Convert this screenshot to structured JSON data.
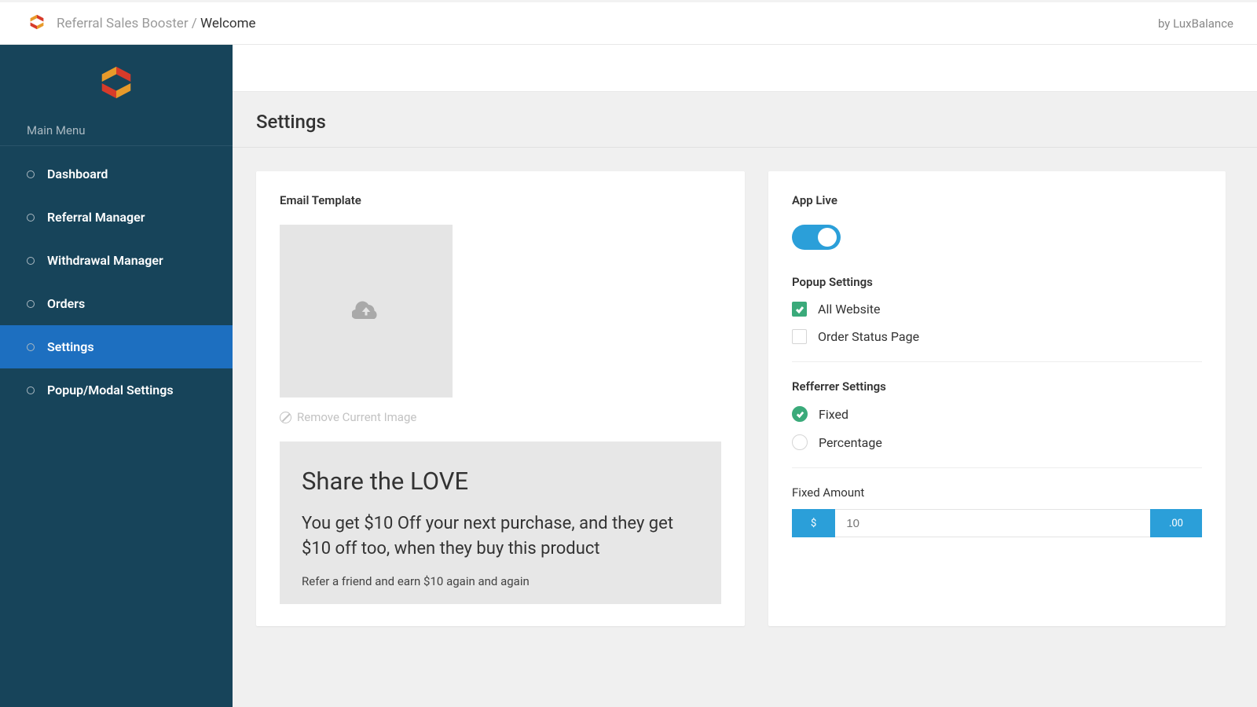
{
  "topbar": {
    "app_name": "Referral Sales Booster",
    "separator": " / ",
    "current": "Welcome",
    "by_text": "by LuxBalance"
  },
  "sidebar": {
    "section_label": "Main Menu",
    "items": [
      {
        "label": "Dashboard"
      },
      {
        "label": "Referral Manager"
      },
      {
        "label": "Withdrawal Manager"
      },
      {
        "label": "Orders"
      },
      {
        "label": "Settings"
      },
      {
        "label": "Popup/Modal Settings"
      }
    ]
  },
  "page": {
    "title": "Settings"
  },
  "left": {
    "email_template_label": "Email Template",
    "remove_image_label": "Remove Current Image",
    "preview_title": "Share the LOVE",
    "preview_body": "You get $10 Off your next purchase, and they get $10 off too, when they buy this product",
    "preview_sub": "Refer a friend and earn $10 again and again"
  },
  "right": {
    "app_live_label": "App Live",
    "popup_heading": "Popup Settings",
    "popup_options": [
      {
        "label": "All Website",
        "checked": true
      },
      {
        "label": "Order Status Page",
        "checked": false
      }
    ],
    "referrer_heading": "Refferrer Settings",
    "referrer_options": [
      {
        "label": "Fixed",
        "checked": true
      },
      {
        "label": "Percentage",
        "checked": false
      }
    ],
    "fixed_amount_label": "Fixed Amount",
    "currency_symbol": "$",
    "amount_value": "10",
    "amount_suffix": ".00"
  }
}
